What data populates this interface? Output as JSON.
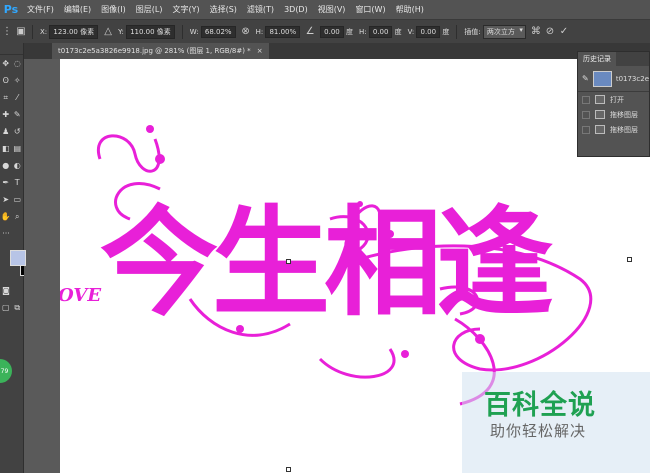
{
  "app": {
    "logo": "Ps"
  },
  "menu": [
    "文件(F)",
    "编辑(E)",
    "图像(I)",
    "图层(L)",
    "文字(Y)",
    "选择(S)",
    "滤镜(T)",
    "3D(D)",
    "视图(V)",
    "窗口(W)",
    "帮助(H)"
  ],
  "options": {
    "x_label": "X:",
    "x_value": "123.00 像素",
    "y_label": "Y:",
    "y_value": "110.00 像素",
    "w_label": "W:",
    "w_value": "68.02%",
    "h_label": "H:",
    "h_value": "81.00%",
    "angle_value": "0.00",
    "angle_unit": "度",
    "hskew_label": "H:",
    "hskew_value": "0.00",
    "hskew_unit": "度",
    "vskew_label": "V:",
    "vskew_value": "0.00",
    "vskew_unit": "度",
    "interp_label": "插值:",
    "interp_value": "两次立方"
  },
  "document": {
    "tab_title": "t0173c2e5a3826e9918.jpg @ 281% (图层 1, RGB/8#) *",
    "close": "×"
  },
  "history": {
    "tab_label": "历史记录",
    "snapshot_name": "t0173c2e",
    "items": [
      {
        "label": "打开"
      },
      {
        "label": "拖移图层"
      },
      {
        "label": "拖移图层"
      }
    ]
  },
  "artwork": {
    "text_main": "今生相逢",
    "text_side": "OVE",
    "color": "#e820d8"
  },
  "watermark": {
    "title": "百科全说",
    "subtitle": "助你轻松解决"
  },
  "badge": {
    "text": "79"
  },
  "colors": {
    "foreground": "#b7c4e6",
    "background": "#000000",
    "accent_ps": "#31a8ff",
    "watermark_green": "#1fa152"
  }
}
